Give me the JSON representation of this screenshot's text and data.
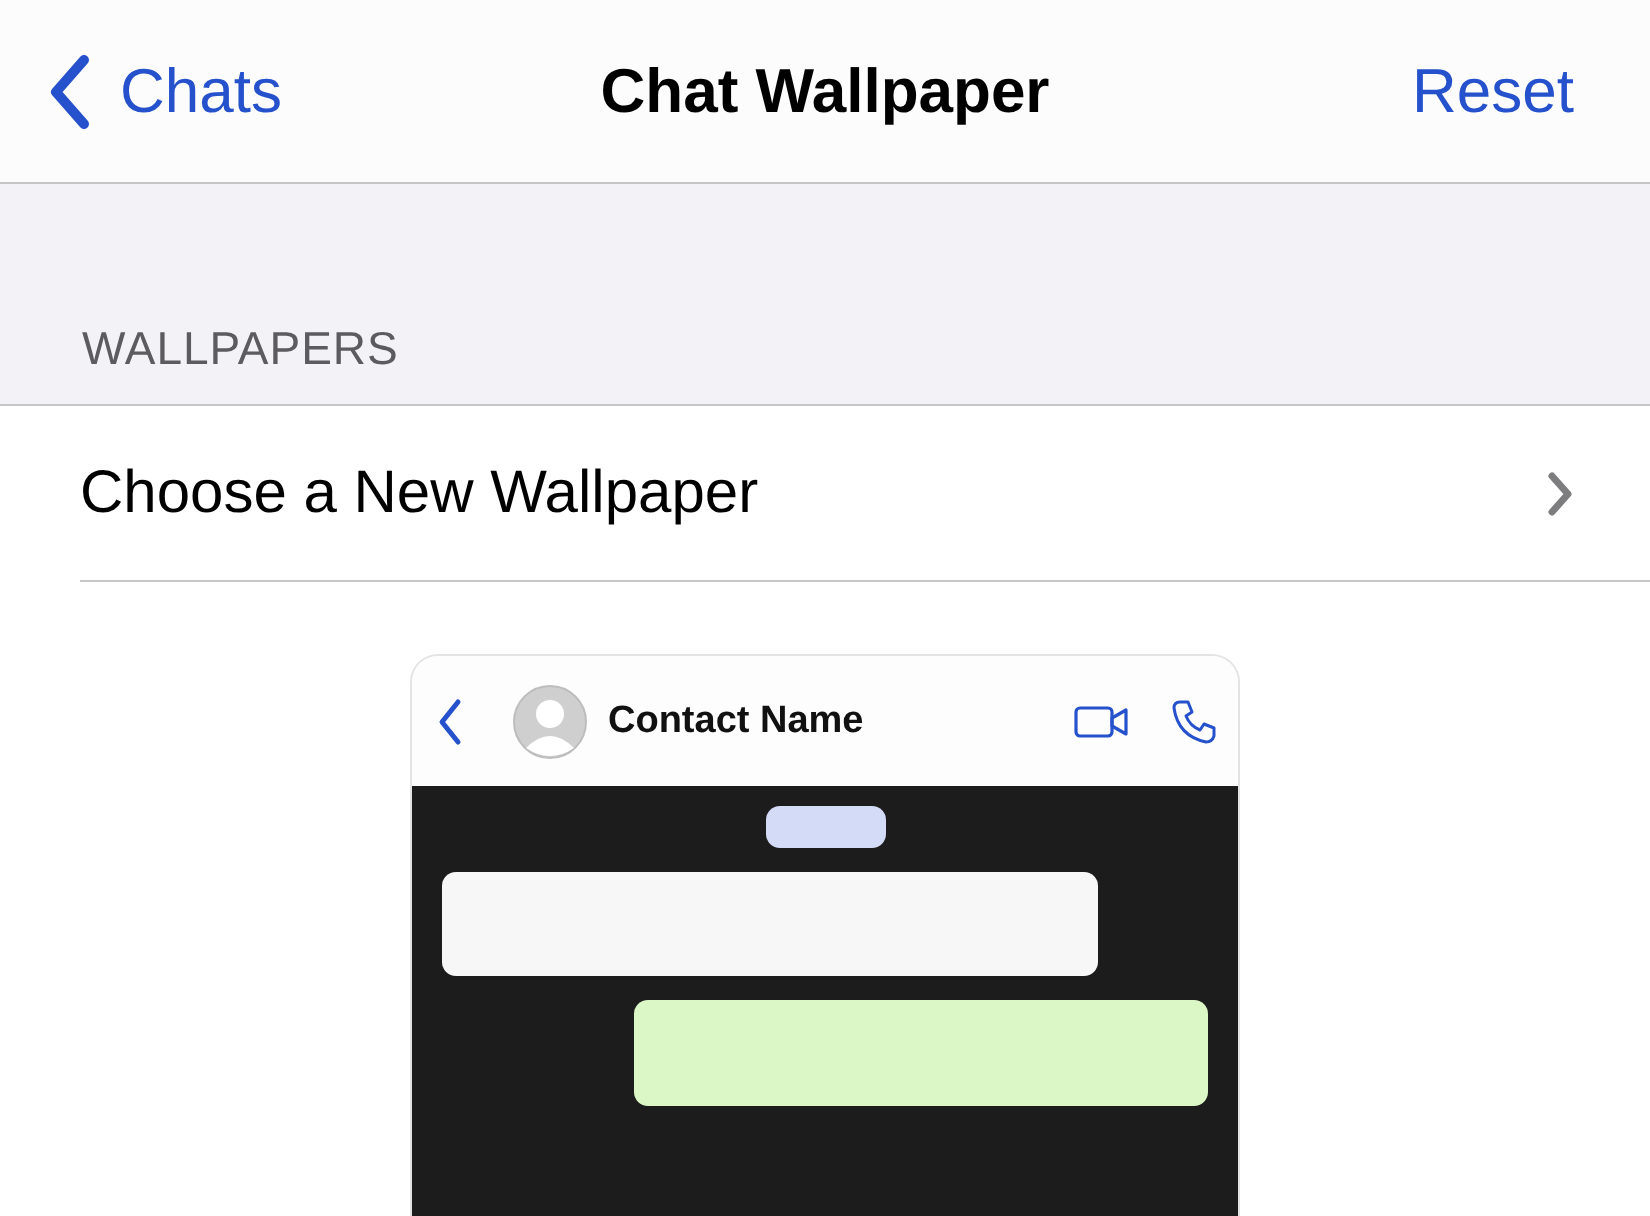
{
  "nav": {
    "back_label": "Chats",
    "title": "Chat Wallpaper",
    "action": "Reset"
  },
  "section": {
    "header": "WALLPAPERS",
    "rows": [
      {
        "label": "Choose a New Wallpaper"
      }
    ]
  },
  "preview": {
    "contact_name": "Contact Name",
    "messages": [
      {
        "kind": "date"
      },
      {
        "kind": "incoming"
      },
      {
        "kind": "outgoing"
      }
    ]
  }
}
